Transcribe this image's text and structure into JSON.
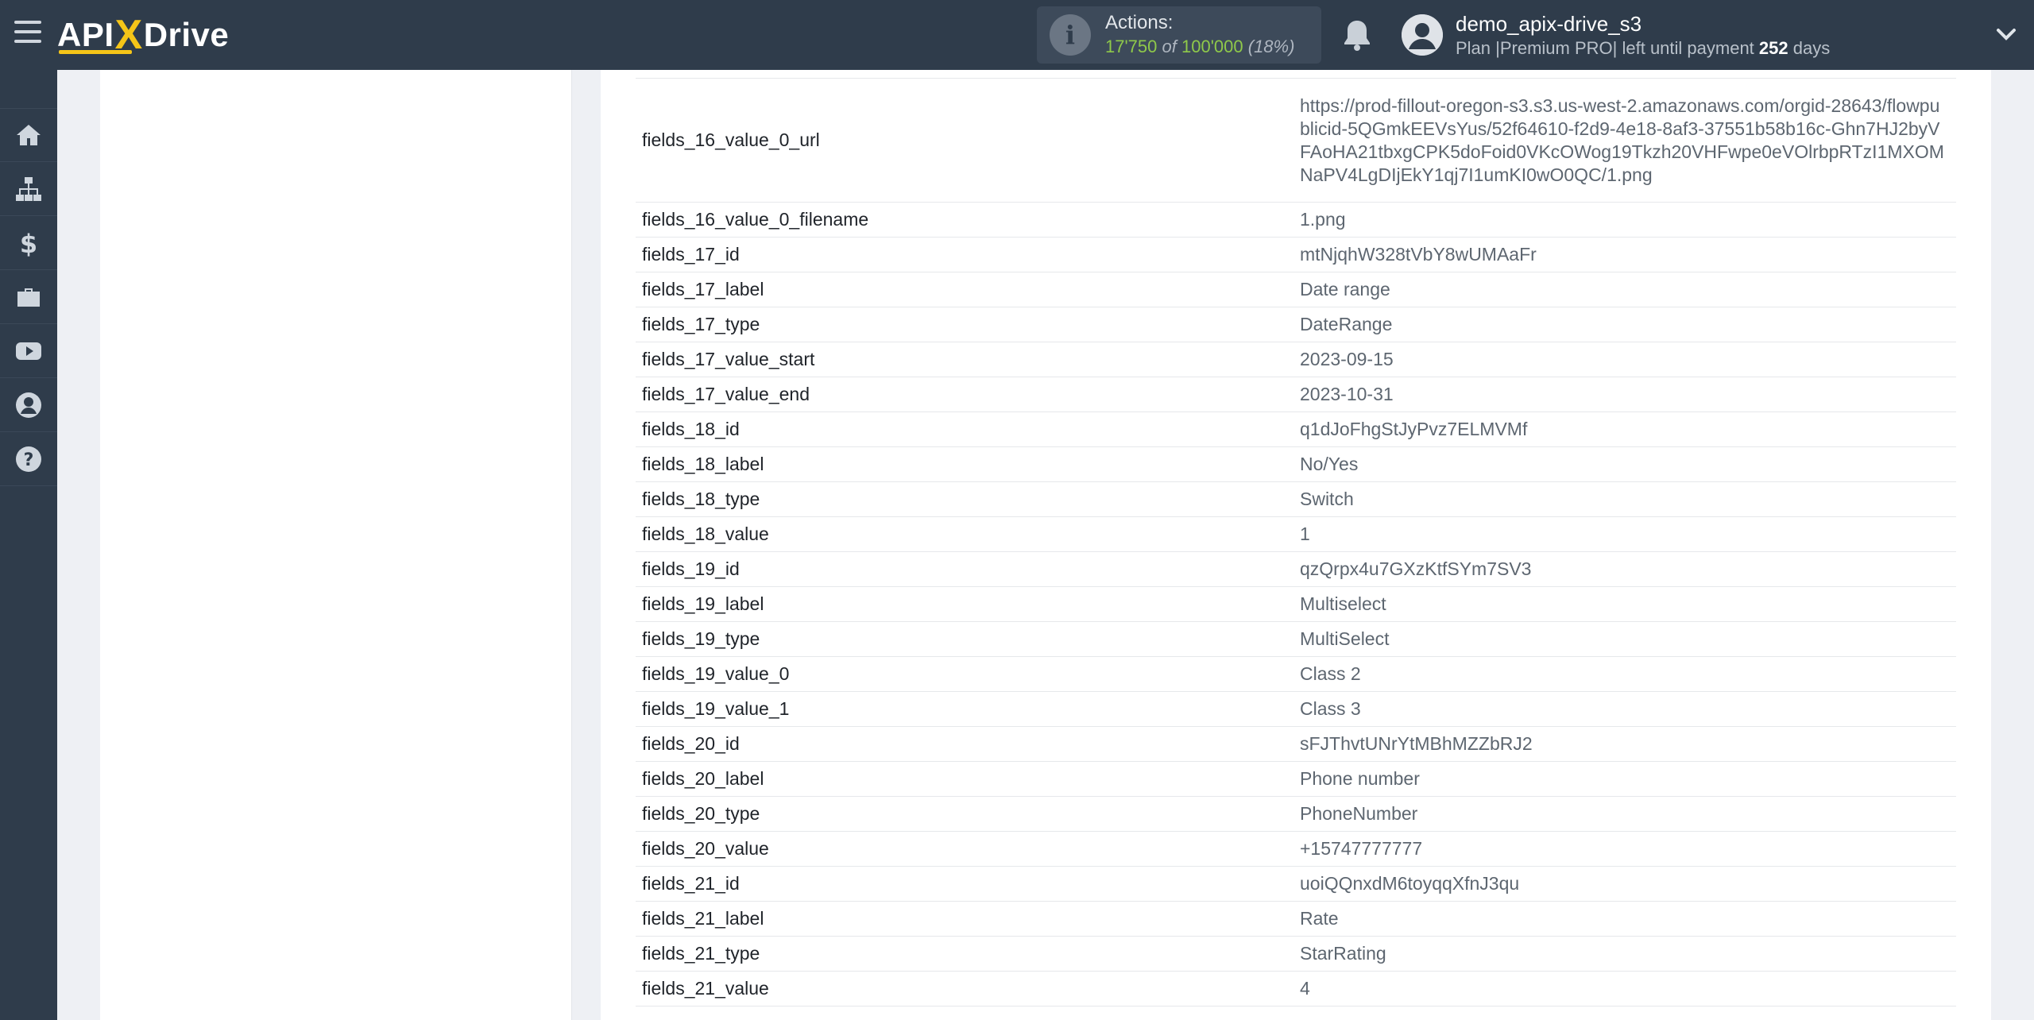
{
  "header": {
    "logo": {
      "part1": "API",
      "x": "X",
      "part2": "Drive"
    },
    "actions": {
      "label": "Actions:",
      "used": "17'750",
      "of": "of",
      "total": "100'000",
      "percent": "(18%)"
    },
    "user": {
      "name": "demo_apix-drive_s3",
      "plan_prefix": "Plan |Premium PRO| left until payment",
      "days_count": "252",
      "days_suffix": "days"
    }
  },
  "sidebar": {
    "items": [
      {
        "icon": "home-icon"
      },
      {
        "icon": "sitemap-icon"
      },
      {
        "icon": "dollar-icon"
      },
      {
        "icon": "briefcase-icon"
      },
      {
        "icon": "youtube-icon"
      },
      {
        "icon": "user-circle-icon"
      },
      {
        "icon": "help-icon"
      }
    ]
  },
  "table": {
    "rows": [
      {
        "key": "fields_16_value_0_url",
        "value": "https://prod-fillout-oregon-s3.s3.us-west-2.amazonaws.com/orgid-28643/flowpublicid-5QGmkEEVsYus/52f64610-f2d9-4e18-8af3-37551b58b16c-Ghn7HJ2byVFAoHA21tbxgCPK5doFoid0VKcOWog19Tkzh20VHFwpe0eVOlrbpRTzI1MXOMNaPV4LgDIjEkY1qj7I1umKI0wO0QC/1.png"
      },
      {
        "key": "fields_16_value_0_filename",
        "value": "1.png"
      },
      {
        "key": "fields_17_id",
        "value": "mtNjqhW328tVbY8wUMAaFr"
      },
      {
        "key": "fields_17_label",
        "value": "Date range"
      },
      {
        "key": "fields_17_type",
        "value": "DateRange"
      },
      {
        "key": "fields_17_value_start",
        "value": "2023-09-15"
      },
      {
        "key": "fields_17_value_end",
        "value": "2023-10-31"
      },
      {
        "key": "fields_18_id",
        "value": "q1dJoFhgStJyPvz7ELMVMf"
      },
      {
        "key": "fields_18_label",
        "value": "No/Yes"
      },
      {
        "key": "fields_18_type",
        "value": "Switch"
      },
      {
        "key": "fields_18_value",
        "value": "1"
      },
      {
        "key": "fields_19_id",
        "value": "qzQrpx4u7GXzKtfSYm7SV3"
      },
      {
        "key": "fields_19_label",
        "value": "Multiselect"
      },
      {
        "key": "fields_19_type",
        "value": "MultiSelect"
      },
      {
        "key": "fields_19_value_0",
        "value": "Class 2"
      },
      {
        "key": "fields_19_value_1",
        "value": "Class 3"
      },
      {
        "key": "fields_20_id",
        "value": "sFJThvtUNrYtMBhMZZbRJ2"
      },
      {
        "key": "fields_20_label",
        "value": "Phone number"
      },
      {
        "key": "fields_20_type",
        "value": "PhoneNumber"
      },
      {
        "key": "fields_20_value",
        "value": "+15747777777"
      },
      {
        "key": "fields_21_id",
        "value": "uoiQQnxdM6toyqqXfnJ3qu"
      },
      {
        "key": "fields_21_label",
        "value": "Rate"
      },
      {
        "key": "fields_21_type",
        "value": "StarRating"
      },
      {
        "key": "fields_21_value",
        "value": "4"
      }
    ]
  }
}
